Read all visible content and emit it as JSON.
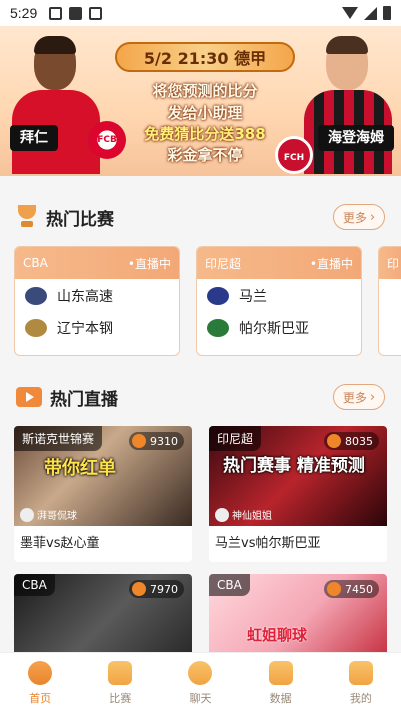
{
  "status_bar": {
    "time": "5:29"
  },
  "banner": {
    "title": "5/2 21:30 德甲",
    "line1": "将您预测的比分",
    "line2": "发给小助理",
    "line3": "免费猜比分送388",
    "line4": "彩金拿不停",
    "left_team": "拜仁",
    "right_team": "海登海姆",
    "right_badge": "FCH",
    "left_badge": "FCB"
  },
  "hot_matches": {
    "title": "热门比赛",
    "more_label": "更多",
    "cards": [
      {
        "league": "CBA",
        "status": "•直播中",
        "team1": "山东高速",
        "team2": "辽宁本钢"
      },
      {
        "league": "印尼超",
        "status": "•直播中",
        "team1": "马兰",
        "team2": "帕尔斯巴亚"
      },
      {
        "league": "印"
      }
    ]
  },
  "hot_live": {
    "title": "热门直播",
    "more_label": "更多",
    "items": [
      {
        "tag": "斯诺克世锦赛",
        "viewers": "9310",
        "overlay": "带你红单",
        "streamer": "湃哥侃球",
        "title": "墨菲vs赵心童"
      },
      {
        "tag": "印尼超",
        "viewers": "8035",
        "overlay": "热门赛事 精准预测",
        "streamer": "神仙姐姐",
        "title": "马兰vs帕尔斯巴亚"
      },
      {
        "tag": "CBA",
        "viewers": "7970",
        "overlay": "",
        "streamer": "",
        "title": ""
      },
      {
        "tag": "CBA",
        "viewers": "7450",
        "overlay": "虹姐聊球",
        "streamer": "",
        "title": ""
      }
    ]
  },
  "bottom_nav": [
    {
      "label": "首页",
      "icon": "home-icon"
    },
    {
      "label": "比赛",
      "icon": "match-icon"
    },
    {
      "label": "聊天",
      "icon": "chat-icon"
    },
    {
      "label": "数据",
      "icon": "data-icon"
    },
    {
      "label": "我的",
      "icon": "profile-icon"
    }
  ],
  "colors": {
    "accent": "#e8852e",
    "card_header": "#f3a877"
  }
}
